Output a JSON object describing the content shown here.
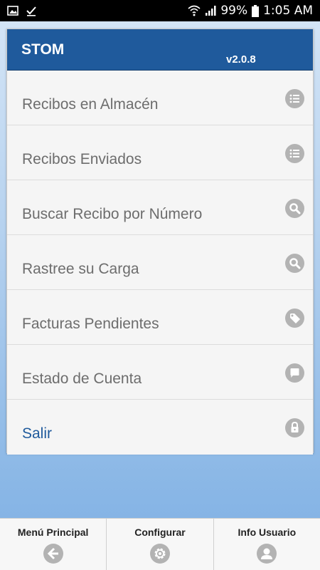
{
  "status_bar": {
    "battery": "99%",
    "time": "1:05 AM",
    "icons": [
      "image-icon",
      "download-done-icon",
      "wifi-icon",
      "signal-icon",
      "battery-icon"
    ]
  },
  "header": {
    "title": "STOM",
    "version": "v2.0.8",
    "color": "#1f5a9c"
  },
  "menu": {
    "items": [
      {
        "label": "Recibos en Almacén",
        "icon": "list-icon"
      },
      {
        "label": "Recibos Enviados",
        "icon": "list-icon"
      },
      {
        "label": "Buscar Recibo por Número",
        "icon": "search-icon"
      },
      {
        "label": "Rastree su Carga",
        "icon": "search-icon"
      },
      {
        "label": "Facturas Pendientes",
        "icon": "tag-icon"
      },
      {
        "label": "Estado de Cuenta",
        "icon": "chat-icon"
      },
      {
        "label": "Salir",
        "icon": "lock-icon"
      }
    ]
  },
  "tabbar": {
    "tabs": [
      {
        "label": "Menú Principal",
        "icon": "back-arrow-icon"
      },
      {
        "label": "Configurar",
        "icon": "gear-icon"
      },
      {
        "label": "Info Usuario",
        "icon": "user-icon"
      }
    ]
  }
}
